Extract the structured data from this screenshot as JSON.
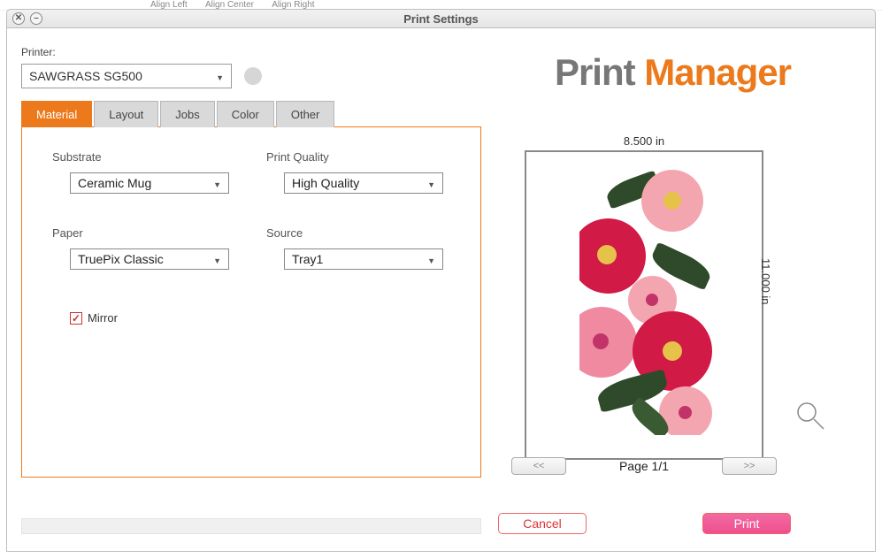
{
  "behind": {
    "a": "Align Left",
    "b": "Align Center",
    "c": "Align Right"
  },
  "window": {
    "title": "Print Settings",
    "printer_label": "Printer:",
    "printer_value": "SAWGRASS SG500"
  },
  "brand": {
    "p1": "Print ",
    "p2": "Manager"
  },
  "tabs": {
    "material": "Material",
    "layout": "Layout",
    "jobs": "Jobs",
    "color": "Color",
    "other": "Other"
  },
  "fields": {
    "substrate_label": "Substrate",
    "substrate_value": "Ceramic Mug",
    "quality_label": "Print Quality",
    "quality_value": "High Quality",
    "paper_label": "Paper",
    "paper_value": "TruePix Classic",
    "source_label": "Source",
    "source_value": "Tray1",
    "mirror_label": "Mirror"
  },
  "preview": {
    "width_label": "8.500 in",
    "height_label": "11.000 in",
    "page_indicator": "Page 1/1",
    "prev": "<<",
    "next": ">>"
  },
  "actions": {
    "cancel": "Cancel",
    "print": "Print"
  }
}
